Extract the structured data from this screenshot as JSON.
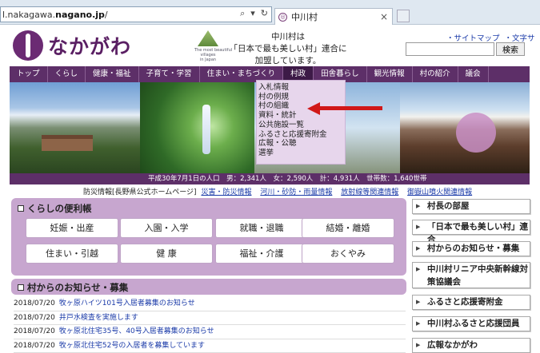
{
  "browser": {
    "address_prefix": "l.nakagawa.",
    "address_domain": "nagano.jp",
    "address_suffix": "/",
    "tab_title": "中川村"
  },
  "header": {
    "logo_text": "なかがわ",
    "villages_caption": "The most beautiful\nvillages\nin Japan",
    "message_lines": [
      "中川村は",
      "「日本で最も美しい村」連合に",
      "加盟しています。"
    ],
    "link_sitemap": "・サイトマップ",
    "link_fontsize": "・文字サイズ",
    "search_placeholder": "",
    "search_button": "検索"
  },
  "nav": {
    "items": [
      "トップ",
      "くらし",
      "健康・福祉",
      "子育て・学習",
      "住まい・まちづくり",
      "村政",
      "田舎暮らし",
      "観光情報",
      "村の紹介",
      "議会"
    ],
    "active_index": 5
  },
  "dropdown": {
    "items": [
      "入札情報",
      "村の例規",
      "村の組織",
      "資料・統計",
      "公共施設一覧",
      "ふるさと応援寄附金",
      "広報・公聴",
      "選挙"
    ]
  },
  "stats_bar": "平成30年7月1日の人口　男：2,341人　女：2,590人　計：4,931人　世帯数：1,640世帯",
  "bousai": {
    "label": "防災情報[長野県公式ホームページ]",
    "links": [
      "災害・防災情報",
      "河川・砂防・雨量情報",
      "放射線等関連情報",
      "御嶽山噴火関連情報"
    ]
  },
  "kurashi": {
    "title": "くらしの便利帳",
    "buttons": [
      "妊娠・出産",
      "入園・入学",
      "就職・退職",
      "結婚・離婚",
      "住まい・引越",
      "健 康",
      "福祉・介護",
      "おくやみ"
    ]
  },
  "news": {
    "title": "村からのお知らせ・募集",
    "items": [
      {
        "date": "2018/07/20",
        "title": "牧ヶ原ハイツ101号入居者募集のお知らせ"
      },
      {
        "date": "2018/07/20",
        "title": "井戸水検査を実施します"
      },
      {
        "date": "2018/07/20",
        "title": "牧ヶ原北住宅35号、40号入居者募集のお知らせ"
      },
      {
        "date": "2018/07/20",
        "title": "牧ヶ原北住宅52号の入居者を募集しています"
      }
    ]
  },
  "sidebar": {
    "items": [
      "村長の部屋",
      "「日本で最も美しい村」連合",
      "村からのお知らせ・募集",
      "中川村リニア中央新幹線対策協議会",
      "ふるさと応援寄附金",
      "中川村ふるさと応援団員",
      "広報なかがわ"
    ]
  },
  "colors": {
    "nav_bg": "#5d2f68",
    "panel_bg": "#c7a6cf",
    "dropdown_bg": "#e7d6ec",
    "arrow": "#d11818",
    "link": "#1a3aa8"
  }
}
